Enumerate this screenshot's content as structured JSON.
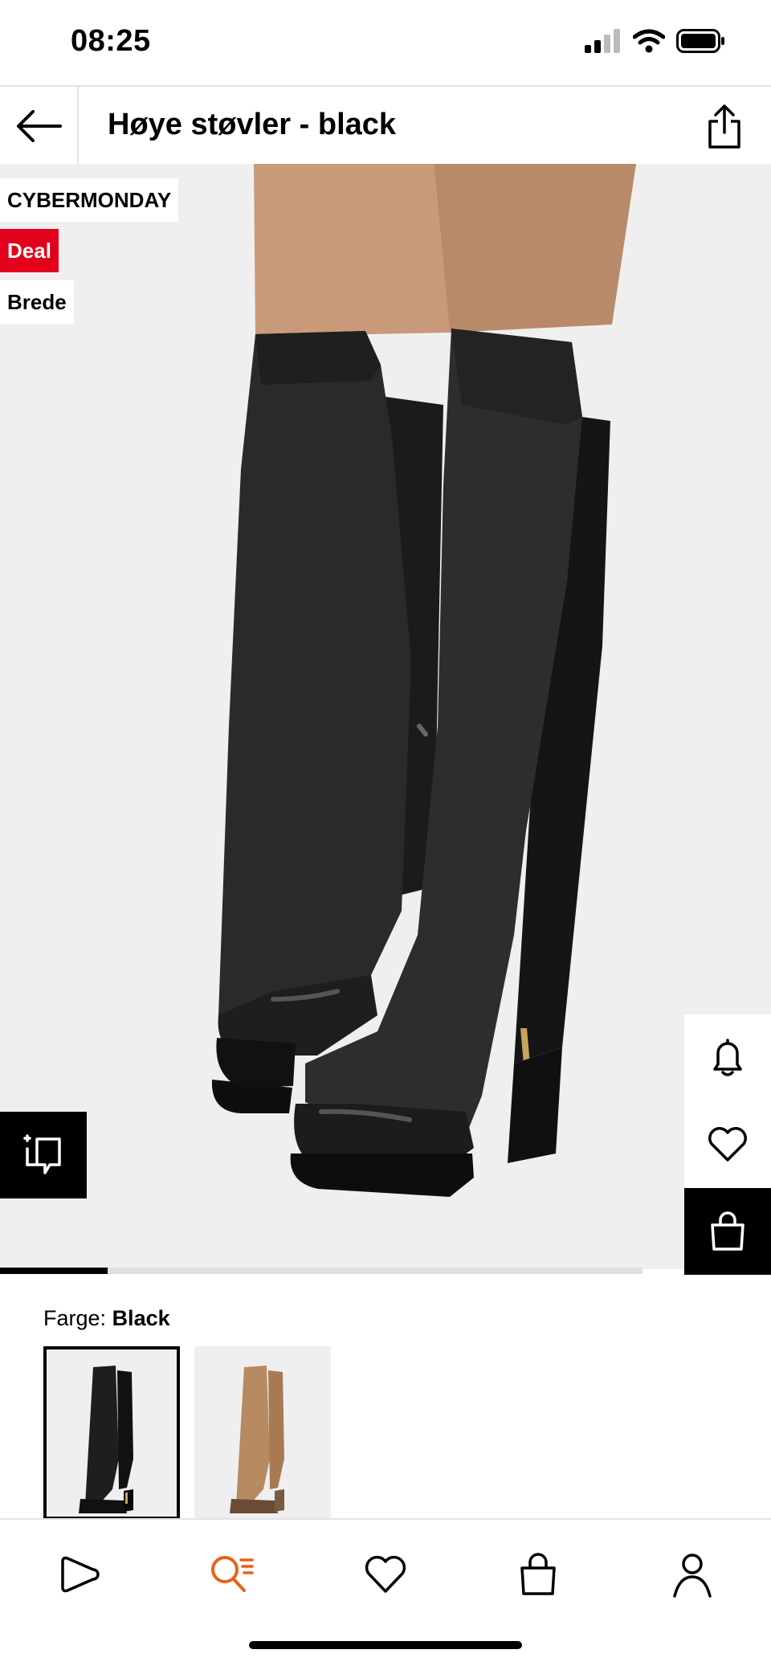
{
  "status_bar": {
    "time": "08:25"
  },
  "header": {
    "title": "Høye støvler - black"
  },
  "badges": {
    "cyber": "CYBERMONDAY",
    "deal": "Deal",
    "brede": "Brede"
  },
  "gallery": {
    "progress_fraction": 0.167
  },
  "color_picker": {
    "label": "Farge:",
    "selected": "Black"
  },
  "icons": {
    "back": "arrow-left-icon",
    "share": "share-icon",
    "notify": "bell-icon",
    "wishlist": "heart-icon",
    "cart": "shopping-bag-icon",
    "fit": "size-fit-icon",
    "nav": [
      "play-icon",
      "search-icon",
      "heart-icon",
      "bag-icon",
      "user-icon"
    ]
  },
  "colors": {
    "accent": "#e2001a",
    "nav_active": "#e8611a",
    "image_bg": "#efefef"
  }
}
